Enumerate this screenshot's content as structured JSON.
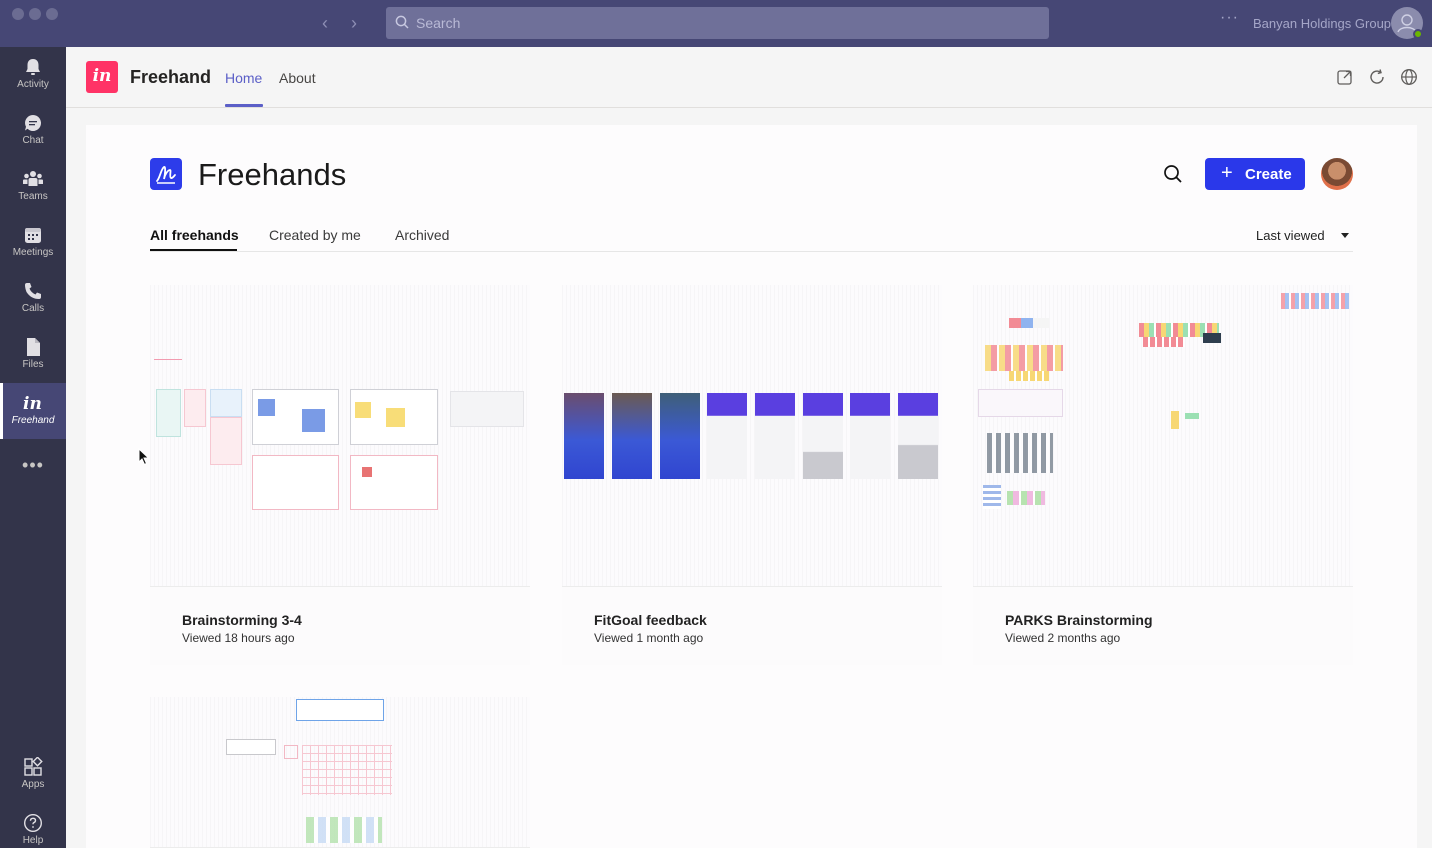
{
  "titlebar": {
    "search_placeholder": "Search",
    "org_name": "Banyan Holdings Group",
    "more": "···"
  },
  "rail": {
    "items": [
      {
        "label": "Activity",
        "icon": "bell-icon"
      },
      {
        "label": "Chat",
        "icon": "chat-icon"
      },
      {
        "label": "Teams",
        "icon": "teams-icon"
      },
      {
        "label": "Meetings",
        "icon": "calendar-icon"
      },
      {
        "label": "Calls",
        "icon": "phone-icon"
      },
      {
        "label": "Files",
        "icon": "file-icon"
      },
      {
        "label": "Freehand",
        "icon": "invision-icon",
        "active": true
      }
    ],
    "more": "•••",
    "bottom": [
      {
        "label": "Apps",
        "icon": "apps-icon"
      },
      {
        "label": "Help",
        "icon": "help-icon"
      }
    ]
  },
  "app_header": {
    "logo_text": "in",
    "name": "Freehand",
    "tabs": [
      {
        "label": "Home",
        "active": true
      },
      {
        "label": "About",
        "active": false
      }
    ]
  },
  "freehands": {
    "title": "Freehands",
    "create_label": "Create",
    "tabs": [
      {
        "label": "All freehands",
        "active": true
      },
      {
        "label": "Created by me",
        "active": false
      },
      {
        "label": "Archived",
        "active": false
      }
    ],
    "sort_label": "Last viewed",
    "cards": [
      {
        "title": "Brainstorming 3-4",
        "subtitle": "Viewed 18 hours ago"
      },
      {
        "title": "FitGoal feedback",
        "subtitle": "Viewed 1 month ago"
      },
      {
        "title": "PARKS Brainstorming",
        "subtitle": "Viewed 2 months ago"
      },
      {
        "title": "",
        "subtitle": ""
      }
    ]
  },
  "colors": {
    "titlebar": "#464775",
    "rail": "#33344a",
    "accent": "#5b5fc7",
    "create_button": "#2a38ea",
    "invision_pink": "#ff3366"
  }
}
